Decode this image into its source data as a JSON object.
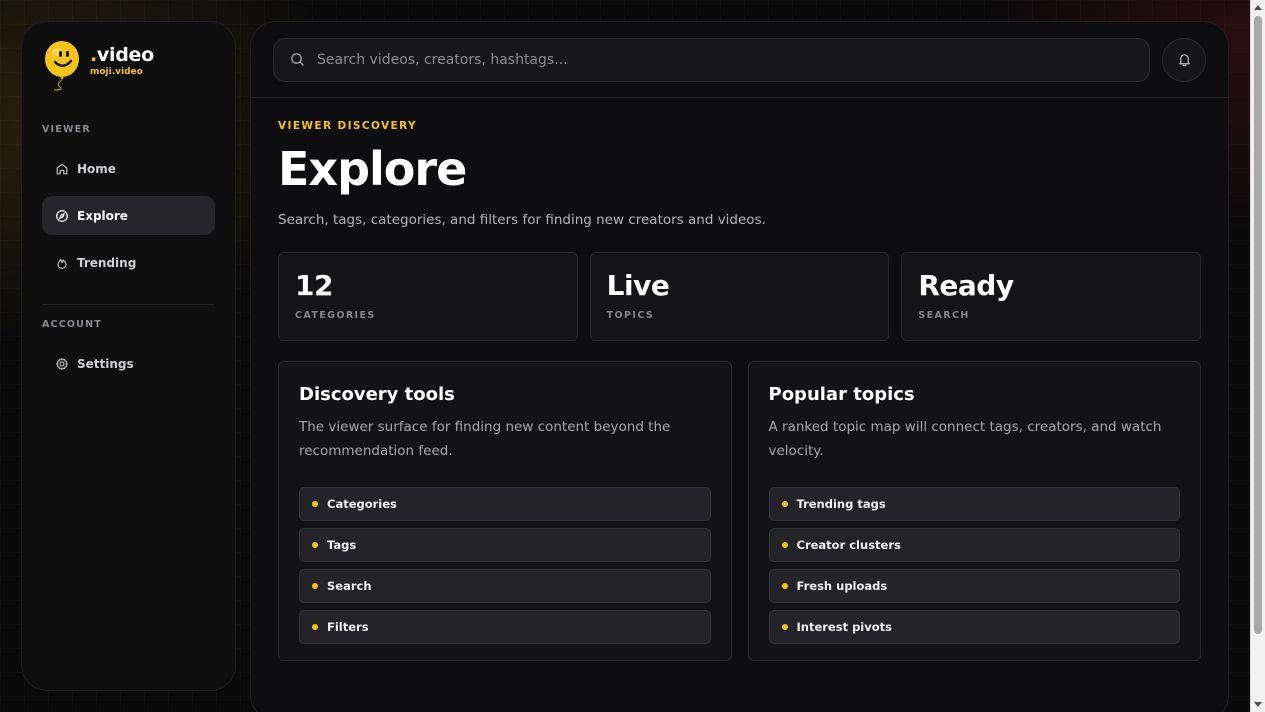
{
  "brand": {
    "title_main": "video",
    "title_dot": ".",
    "subtitle": "moji.video"
  },
  "sidebar": {
    "viewer_label": "VIEWER",
    "viewer_items": [
      {
        "label": "Home",
        "icon": "home-icon"
      },
      {
        "label": "Explore",
        "icon": "compass-icon",
        "active": true
      },
      {
        "label": "Trending",
        "icon": "flame-icon"
      }
    ],
    "account_label": "ACCOUNT",
    "account_items": [
      {
        "label": "Settings",
        "icon": "gear-icon"
      }
    ]
  },
  "search": {
    "placeholder": "Search videos, creators, hashtags..."
  },
  "header": {
    "eyebrow": "VIEWER DISCOVERY",
    "title": "Explore",
    "description": "Search, tags, categories, and filters for finding new creators and videos."
  },
  "stats": [
    {
      "value": "12",
      "label": "CATEGORIES"
    },
    {
      "value": "Live",
      "label": "TOPICS"
    },
    {
      "value": "Ready",
      "label": "SEARCH"
    }
  ],
  "cards": [
    {
      "title": "Discovery tools",
      "description": "The viewer surface for finding new content beyond the recommendation feed.",
      "items": [
        "Categories",
        "Tags",
        "Search",
        "Filters"
      ]
    },
    {
      "title": "Popular topics",
      "description": "A ranked topic map will connect tags, creators, and watch velocity.",
      "items": [
        "Trending tags",
        "Creator clusters",
        "Fresh uploads",
        "Interest pivots"
      ]
    }
  ],
  "colors": {
    "accent": "#f5c418",
    "background": "#0a0a0b",
    "panel": "#0e0e10"
  }
}
